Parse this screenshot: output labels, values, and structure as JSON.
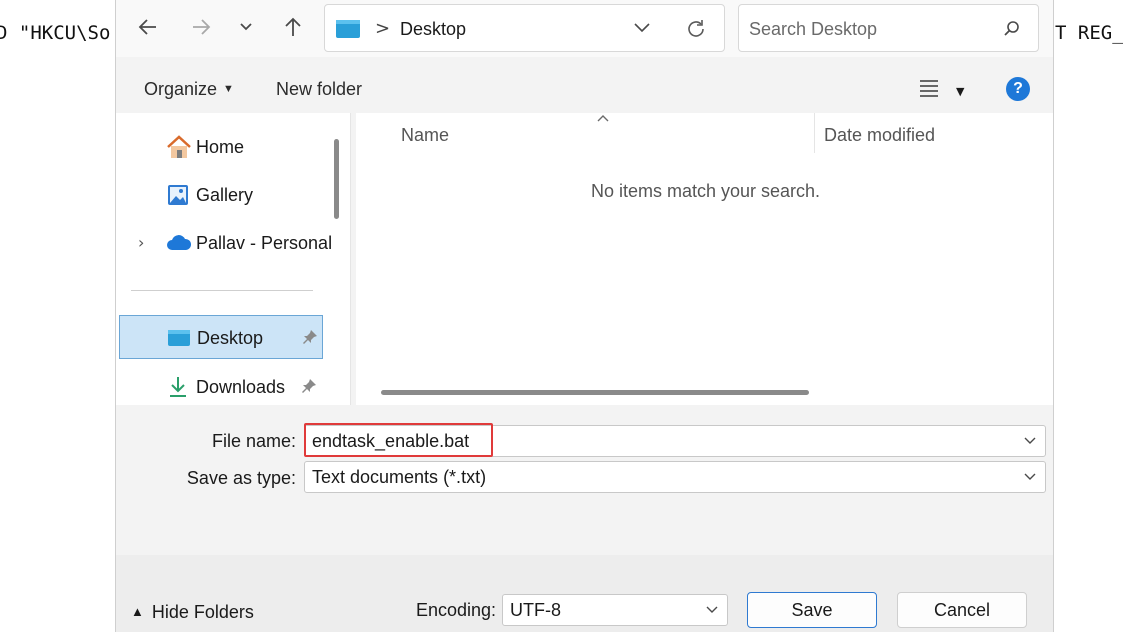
{
  "background": {
    "left_text": "D \"HKCU\\So",
    "right_text": "T REG_"
  },
  "nav": {
    "back_icon": "arrow-left-icon",
    "forward_icon": "arrow-right-icon",
    "recent_icon": "chevron-down-icon",
    "up_icon": "arrow-up-icon"
  },
  "address": {
    "crumb": "Desktop",
    "separator": ">"
  },
  "search": {
    "placeholder": "Search Desktop"
  },
  "command_bar": {
    "organize": "Organize",
    "new_folder": "New folder",
    "help": "?"
  },
  "nav_pane": {
    "items": [
      {
        "label": "Home",
        "icon": "home-icon"
      },
      {
        "label": "Gallery",
        "icon": "gallery-icon"
      },
      {
        "label": "Pallav - Personal",
        "icon": "onedrive-cloud-icon"
      },
      {
        "label": "Desktop",
        "icon": "desktop-folder-icon",
        "pinned": true,
        "selected": true
      },
      {
        "label": "Downloads",
        "icon": "download-arrow-icon",
        "pinned": true
      }
    ]
  },
  "file_list": {
    "columns": [
      "Name",
      "Date modified"
    ],
    "empty_message": "No items match your search."
  },
  "form": {
    "file_name_label": "File name:",
    "file_name_value": "endtask_enable.bat",
    "save_type_label": "Save as type:",
    "save_type_value": "Text documents (*.txt)",
    "encoding_label": "Encoding:",
    "encoding_value": "UTF-8"
  },
  "footer": {
    "hide_folders": "Hide Folders",
    "save": "Save",
    "cancel": "Cancel"
  },
  "colors": {
    "accent": "#1e78d8",
    "selection_bg": "#cce4f7",
    "highlight_box": "#e03a3a"
  }
}
